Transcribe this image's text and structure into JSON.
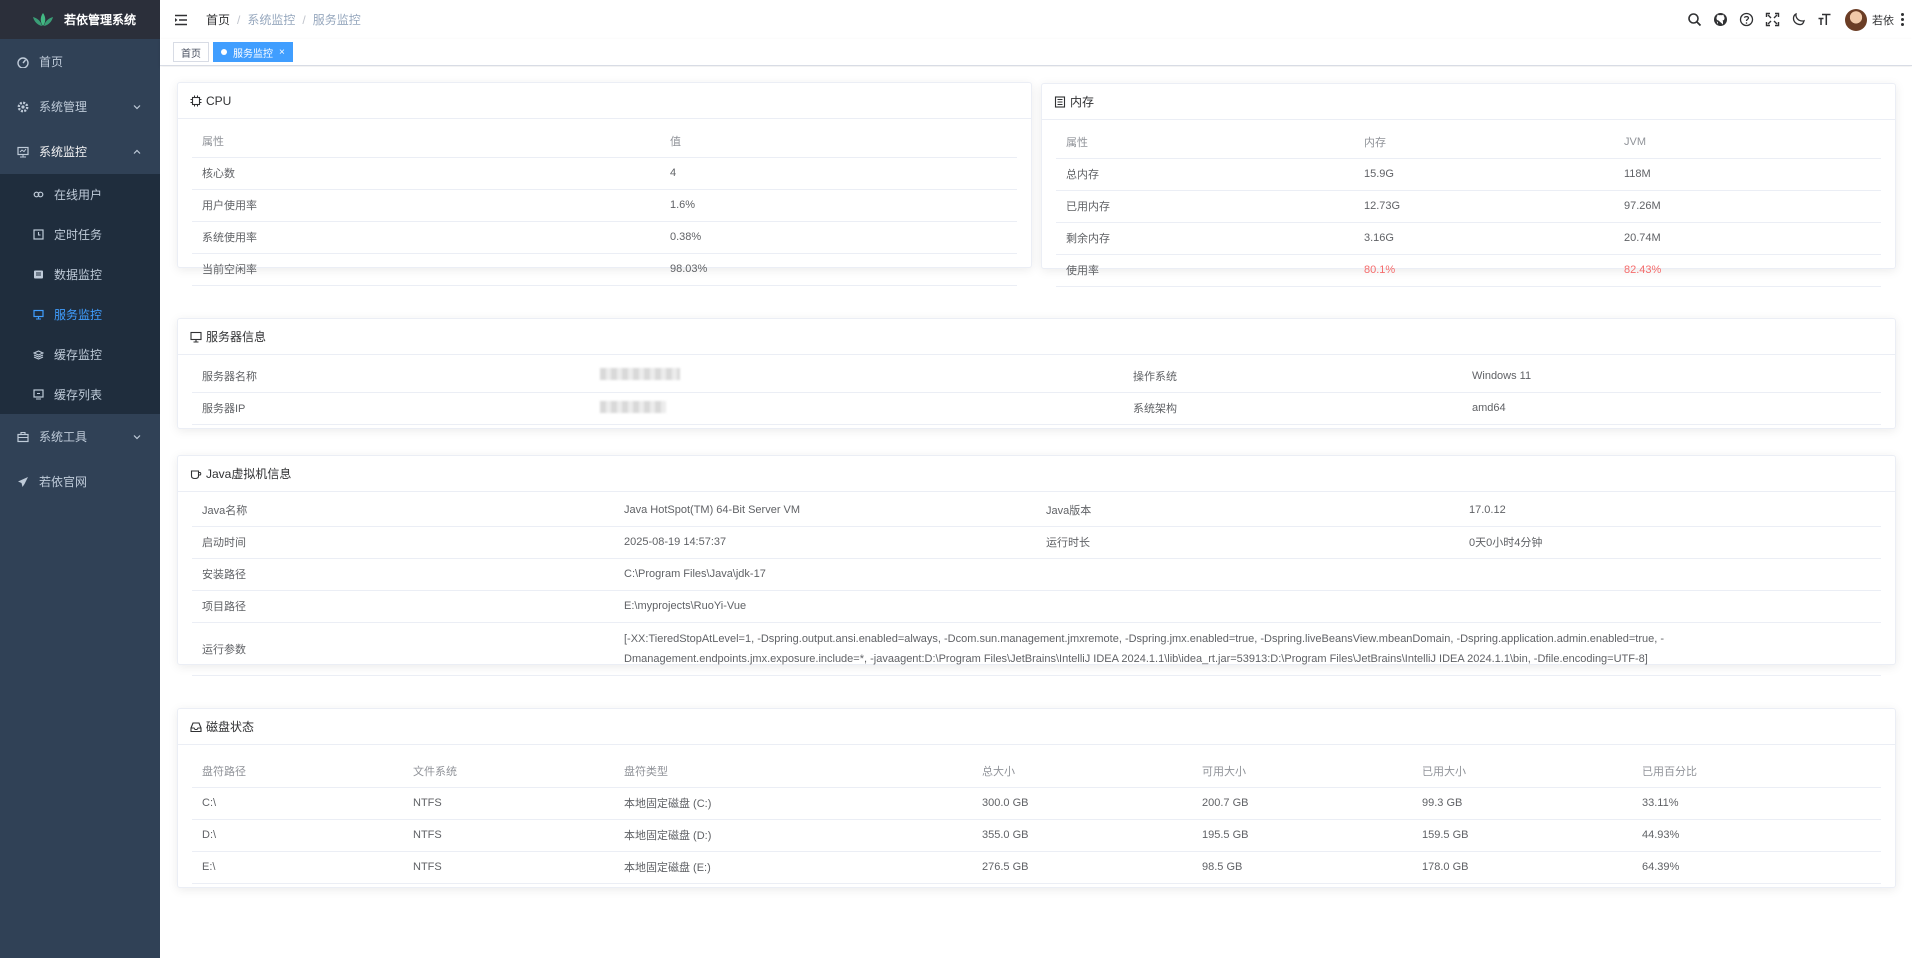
{
  "app": {
    "title": "若依管理系统"
  },
  "sidebar": {
    "items": [
      {
        "label": "首页",
        "icon": "dashboard-icon"
      },
      {
        "label": "系统管理",
        "icon": "gear-icon"
      },
      {
        "label": "系统监控",
        "icon": "monitor-icon"
      },
      {
        "label": "系统工具",
        "icon": "toolbox-icon"
      },
      {
        "label": "若依官网",
        "icon": "paper-plane-icon"
      }
    ],
    "monitor_children": [
      {
        "label": "在线用户",
        "icon": "online-icon"
      },
      {
        "label": "定时任务",
        "icon": "job-icon"
      },
      {
        "label": "数据监控",
        "icon": "druid-icon"
      },
      {
        "label": "服务监控",
        "icon": "server-icon",
        "active": true
      },
      {
        "label": "缓存监控",
        "icon": "redis-icon"
      },
      {
        "label": "缓存列表",
        "icon": "redis-list-icon"
      }
    ]
  },
  "header": {
    "breadcrumb": [
      "首页",
      "系统监控",
      "服务监控"
    ],
    "username": "若依"
  },
  "tags": [
    {
      "label": "首页"
    },
    {
      "label": "服务监控",
      "active": true,
      "close": "×"
    }
  ],
  "cpu": {
    "title": "CPU",
    "headers": [
      "属性",
      "值"
    ],
    "rows": [
      [
        "核心数",
        "4"
      ],
      [
        "用户使用率",
        "1.6%"
      ],
      [
        "系统使用率",
        "0.38%"
      ],
      [
        "当前空闲率",
        "98.03%"
      ]
    ]
  },
  "memory": {
    "title": "内存",
    "headers": [
      "属性",
      "内存",
      "JVM"
    ],
    "rows": [
      [
        "总内存",
        "15.9G",
        "118M"
      ],
      [
        "已用内存",
        "12.73G",
        "97.26M"
      ],
      [
        "剩余内存",
        "3.16G",
        "20.74M"
      ],
      [
        "使用率",
        "80.1%",
        "82.43%"
      ]
    ]
  },
  "server": {
    "title": "服务器信息",
    "rows": [
      [
        "服务器名称",
        "",
        "操作系统",
        "Windows 11"
      ],
      [
        "服务器IP",
        "",
        "系统架构",
        "amd64"
      ]
    ]
  },
  "jvm": {
    "title": "Java虚拟机信息",
    "rows": [
      [
        "Java名称",
        "Java HotSpot(TM) 64-Bit Server VM",
        "Java版本",
        "17.0.12"
      ],
      [
        "启动时间",
        "2025-08-19 14:57:37",
        "运行时长",
        "0天0小时4分钟"
      ]
    ],
    "install_label": "安装路径",
    "install_path": "C:\\Program Files\\Java\\jdk-17",
    "project_label": "项目路径",
    "project_path": "E:\\myprojects\\RuoYi-Vue",
    "args_label": "运行参数",
    "args_line1": "[-XX:TieredStopAtLevel=1, -Dspring.output.ansi.enabled=always, -Dcom.sun.management.jmxremote, -Dspring.jmx.enabled=true, -Dspring.liveBeansView.mbeanDomain, -Dspring.application.admin.enabled=true, -",
    "args_line2": "Dmanagement.endpoints.jmx.exposure.include=*, -javaagent:D:\\Program Files\\JetBrains\\IntelliJ IDEA 2024.1.1\\lib\\idea_rt.jar=53913:D:\\Program Files\\JetBrains\\IntelliJ IDEA 2024.1.1\\bin, -Dfile.encoding=UTF-8]"
  },
  "disk": {
    "title": "磁盘状态",
    "headers": [
      "盘符路径",
      "文件系统",
      "盘符类型",
      "总大小",
      "可用大小",
      "已用大小",
      "已用百分比"
    ],
    "rows": [
      [
        "C:\\",
        "NTFS",
        "本地固定磁盘 (C:)",
        "300.0 GB",
        "200.7 GB",
        "99.3 GB",
        "33.11%"
      ],
      [
        "D:\\",
        "NTFS",
        "本地固定磁盘 (D:)",
        "355.0 GB",
        "195.5 GB",
        "159.5 GB",
        "44.93%"
      ],
      [
        "E:\\",
        "NTFS",
        "本地固定磁盘 (E:)",
        "276.5 GB",
        "98.5 GB",
        "178.0 GB",
        "64.39%"
      ]
    ]
  }
}
